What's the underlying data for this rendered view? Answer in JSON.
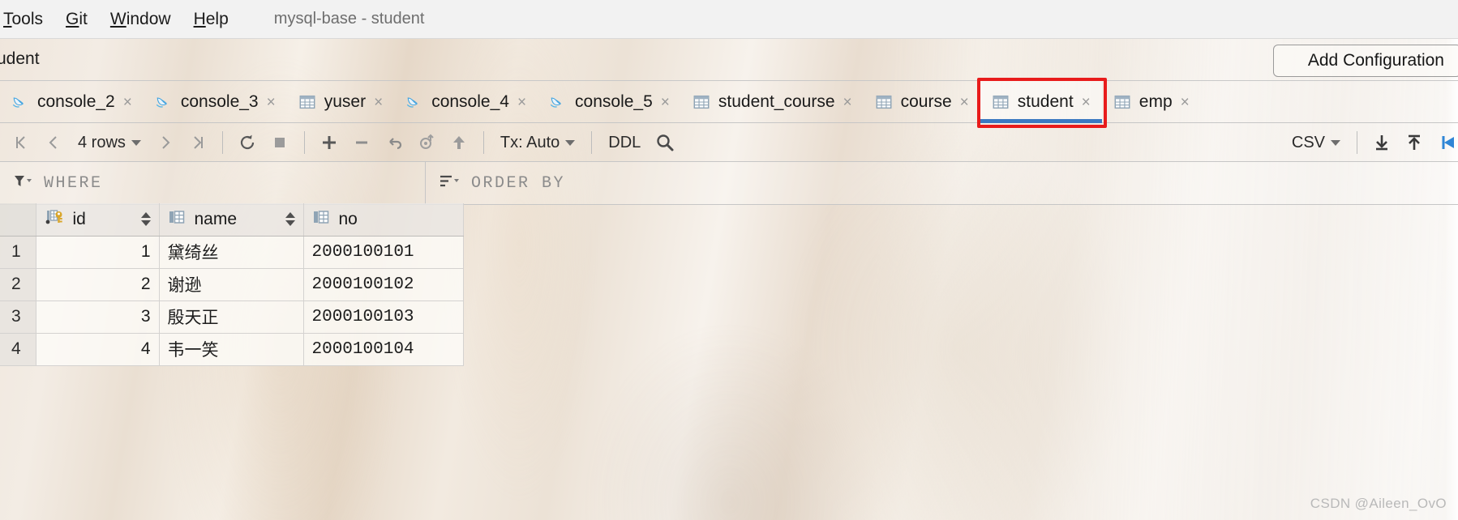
{
  "menu": {
    "items": [
      {
        "label": "Tools",
        "mnemonic": "T",
        "rest": "ools"
      },
      {
        "label": "Git",
        "mnemonic": "G",
        "rest": "it"
      },
      {
        "label": "Window",
        "mnemonic": "W",
        "rest": "indow"
      },
      {
        "label": "Help",
        "mnemonic": "H",
        "rest": "elp"
      }
    ],
    "window_title": "mysql-base - student"
  },
  "breadcrumb": {
    "text": "udent",
    "add_configuration_label": "Add Configuration"
  },
  "tabs": {
    "items": [
      {
        "label": "console_2",
        "icon": "dolphin-icon",
        "close": "×",
        "selected": false
      },
      {
        "label": "console_3",
        "icon": "dolphin-icon",
        "close": "×",
        "selected": false
      },
      {
        "label": "yuser",
        "icon": "table-icon",
        "close": "×",
        "selected": false
      },
      {
        "label": "console_4",
        "icon": "dolphin-icon",
        "close": "×",
        "selected": false
      },
      {
        "label": "console_5",
        "icon": "dolphin-icon",
        "close": "×",
        "selected": false
      },
      {
        "label": "student_course",
        "icon": "table-icon",
        "close": "×",
        "selected": false
      },
      {
        "label": "course",
        "icon": "table-icon",
        "close": "×",
        "selected": false
      },
      {
        "label": "student",
        "icon": "table-icon",
        "close": "×",
        "selected": true
      },
      {
        "label": "emp",
        "icon": "table-icon",
        "close": "×",
        "selected": false
      }
    ],
    "highlight_color": "#e81b1b",
    "selected_underline_color": "#3c79c2"
  },
  "toolbar": {
    "first_page_icon": "first-page-icon",
    "prev_page_icon": "previous-page-icon",
    "row_count_label": "4 rows",
    "next_page_icon": "next-page-icon",
    "last_page_icon": "last-page-icon",
    "reload_icon": "reload-icon",
    "stop_icon": "stop-icon",
    "add_row_icon": "add-row-icon",
    "delete_row_icon": "delete-row-icon",
    "revert_icon": "revert-changes-icon",
    "revert_selected_icon": "revert-selected-icon",
    "submit_icon": "submit-changes-icon",
    "tx_label": "Tx: Auto",
    "ddl_label": "DDL",
    "search_icon": "search-icon",
    "export_format_label": "CSV",
    "download_icon": "download-icon",
    "upload_icon": "upload-icon",
    "open_in_editor_icon": "open-in-editor-icon"
  },
  "filter": {
    "where_icon": "filter-icon",
    "where_placeholder": "WHERE",
    "orderby_icon": "sort-icon",
    "orderby_placeholder": "ORDER BY"
  },
  "grid": {
    "columns": [
      {
        "name": "id",
        "icon": "primary-key-icon",
        "sortable": true
      },
      {
        "name": "name",
        "icon": "column-icon",
        "sortable": true
      },
      {
        "name": "no",
        "icon": "column-icon",
        "sortable": false
      }
    ],
    "rows": [
      {
        "n": "1",
        "id": "1",
        "name": "黛绮丝",
        "no": "2000100101"
      },
      {
        "n": "2",
        "id": "2",
        "name": "谢逊",
        "no": "2000100102"
      },
      {
        "n": "3",
        "id": "3",
        "name": "殷天正",
        "no": "2000100103"
      },
      {
        "n": "4",
        "id": "4",
        "name": "韦一笑",
        "no": "2000100104"
      }
    ]
  },
  "watermark": {
    "text": "CSDN @Aileen_OvO"
  }
}
